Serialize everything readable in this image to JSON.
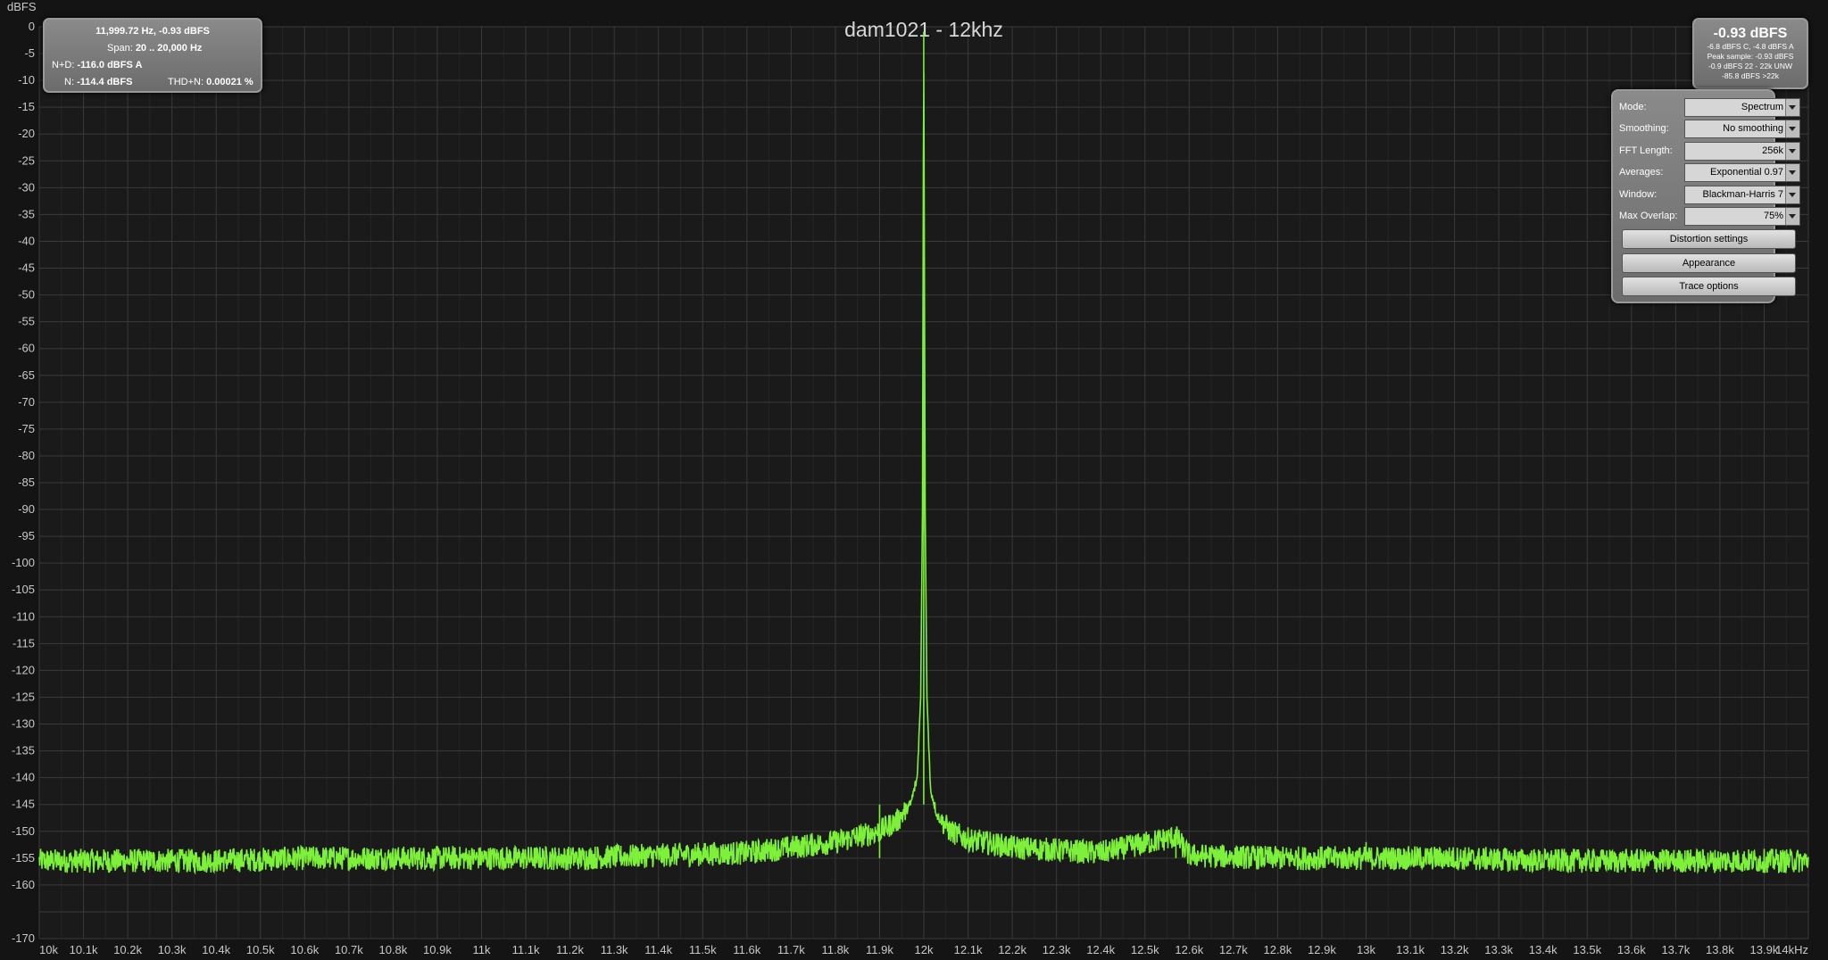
{
  "title": "dam1021 - 12khz",
  "y_unit": "dBFS",
  "info": {
    "cursor": "11,999.72 Hz, -0.93 dBFS",
    "span_label": "Span:",
    "span_value": "20 .. 20,000 Hz",
    "nd_label": "N+D:",
    "nd_value": "-116.0 dBFS A",
    "n_label": "N:",
    "n_value": "-114.4 dBFS",
    "thdn_label": "THD+N:",
    "thdn_value": "0.00021 %"
  },
  "peak": {
    "main": "-0.93 dBFS",
    "line1": "-6.8 dBFS C, -4.8 dBFS A",
    "line2": "Peak sample: -0.93 dBFS",
    "line3": "-0.9 dBFS 22 - 22k UNW",
    "line4": "-85.8 dBFS >22k"
  },
  "settings": {
    "mode_label": "Mode:",
    "mode_value": "Spectrum",
    "smoothing_label": "Smoothing:",
    "smoothing_value": "No  smoothing",
    "fft_label": "FFT Length:",
    "fft_value": "256k",
    "avg_label": "Averages:",
    "avg_value": "Exponential 0.97",
    "window_label": "Window:",
    "window_value": "Blackman-Harris 7",
    "overlap_label": "Max Overlap:",
    "overlap_value": "75%",
    "distortion_button": "Distortion settings",
    "appearance_button": "Appearance",
    "trace_button": "Trace options"
  },
  "colors": {
    "trace": "#7df03a",
    "grid": "#3a3a3a",
    "background": "#141414"
  },
  "chart_data": {
    "type": "line",
    "title": "dam1021 - 12khz",
    "ylabel": "dBFS",
    "xlim": [
      10000,
      14000
    ],
    "ylim": [
      -170,
      0
    ],
    "grid": true,
    "y_ticks": [
      "0",
      "-5",
      "-10",
      "-15",
      "-20",
      "-25",
      "-30",
      "-35",
      "-40",
      "-45",
      "-50",
      "-55",
      "-60",
      "-65",
      "-70",
      "-75",
      "-80",
      "-85",
      "-90",
      "-95",
      "-100",
      "-105",
      "-110",
      "-115",
      "-120",
      "-125",
      "-130",
      "-135",
      "-140",
      "-145",
      "-150",
      "-155",
      "-160",
      "-170"
    ],
    "x_ticks": [
      "10k",
      "10.1k",
      "10.2k",
      "10.3k",
      "10.4k",
      "10.5k",
      "10.6k",
      "10.7k",
      "10.8k",
      "10.9k",
      "11k",
      "11.1k",
      "11.2k",
      "11.3k",
      "11.4k",
      "11.5k",
      "11.6k",
      "11.7k",
      "11.8k",
      "11.9k",
      "12k",
      "12.1k",
      "12.2k",
      "12.3k",
      "12.4k",
      "12.5k",
      "12.6k",
      "12.7k",
      "12.8k",
      "12.9k",
      "13k",
      "13.1k",
      "13.2k",
      "13.3k",
      "13.4k",
      "13.5k",
      "13.6k",
      "13.7k",
      "13.8k",
      "13.9k",
      "14kHz"
    ],
    "series": [
      {
        "x": [
          10000,
          10200,
          10400,
          10600,
          10800,
          11000,
          11200,
          11400,
          11600,
          11700,
          11800,
          11850,
          11900,
          11940,
          11970,
          11985,
          11993,
          11997,
          11999.72,
          12003,
          12007,
          12015,
          12030,
          12060,
          12100,
          12200,
          12300,
          12400,
          12570,
          12600,
          12800,
          13000,
          13200,
          13400,
          13600,
          13800,
          14000
        ],
        "y": [
          -155.5,
          -155.5,
          -155.5,
          -155,
          -155,
          -155,
          -155,
          -154.5,
          -154,
          -153,
          -152,
          -151,
          -150,
          -148,
          -145,
          -140,
          -125,
          -90,
          -0.93,
          -90,
          -125,
          -142,
          -147,
          -150,
          -151.5,
          -153,
          -153.5,
          -154,
          -151,
          -154.5,
          -155,
          -155,
          -155,
          -155.5,
          -155.5,
          -155.5,
          -155.5
        ]
      }
    ],
    "spurs": [
      {
        "x": 11900,
        "y": -145
      },
      {
        "x": 12570,
        "y": -150
      },
      {
        "x": 13000,
        "y": -152
      }
    ]
  }
}
